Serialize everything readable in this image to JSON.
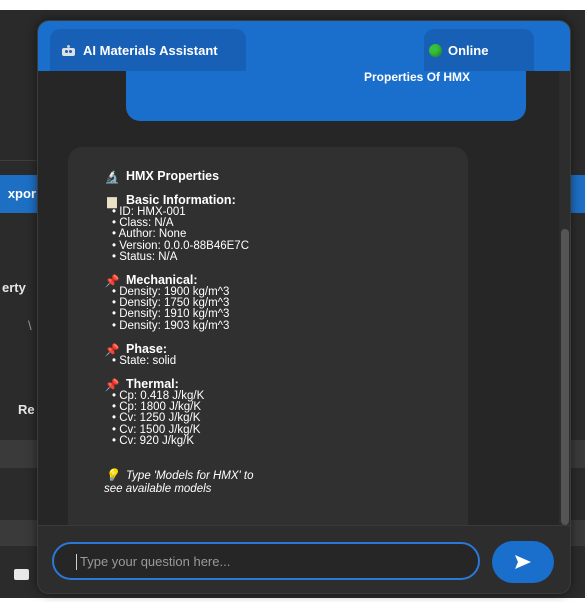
{
  "background_app": {
    "left_tab_text": "xpor",
    "left_label_1": "erty",
    "left_label_2": "Re",
    "left_mark": "\\"
  },
  "chat": {
    "header": {
      "title": "AI Materials Assistant",
      "status": "Online"
    },
    "user_message": "Properties Of HMX",
    "bot_message": {
      "title": "HMX Properties",
      "sections": [
        {
          "icon": "folder-icon",
          "title": "Basic Information:",
          "items": [
            "• ID: HMX-001",
            "• Class: N/A",
            "• Author: None",
            "• Version: 0.0.0-88B46E7C",
            "• Status: N/A"
          ]
        },
        {
          "icon": "pushpin-icon",
          "title": "Mechanical:",
          "items": [
            "• Density: 1900 kg/m^3",
            "• Density: 1750 kg/m^3",
            "• Density: 1910 kg/m^3",
            "• Density: 1903 kg/m^3"
          ]
        },
        {
          "icon": "pushpin-icon",
          "title": "Phase:",
          "items": [
            "• State: solid"
          ]
        },
        {
          "icon": "pushpin-icon",
          "title": "Thermal:",
          "items": [
            "• Cp: 0.418 J/kg/K",
            "• Cp: 1800 J/kg/K",
            "• Cv: 1250 J/kg/K",
            "• Cv: 1500 J/kg/K",
            "• Cv: 920 J/kg/K"
          ]
        }
      ],
      "tip_line1": "Type 'Models for HMX' to",
      "tip_line2": "see available models"
    },
    "input": {
      "placeholder": "Type your question here...",
      "value": ""
    }
  },
  "colors": {
    "accent": "#1b6fcc",
    "online": "#36c23a",
    "window_bg": "#262626",
    "card_bg": "#303030"
  }
}
